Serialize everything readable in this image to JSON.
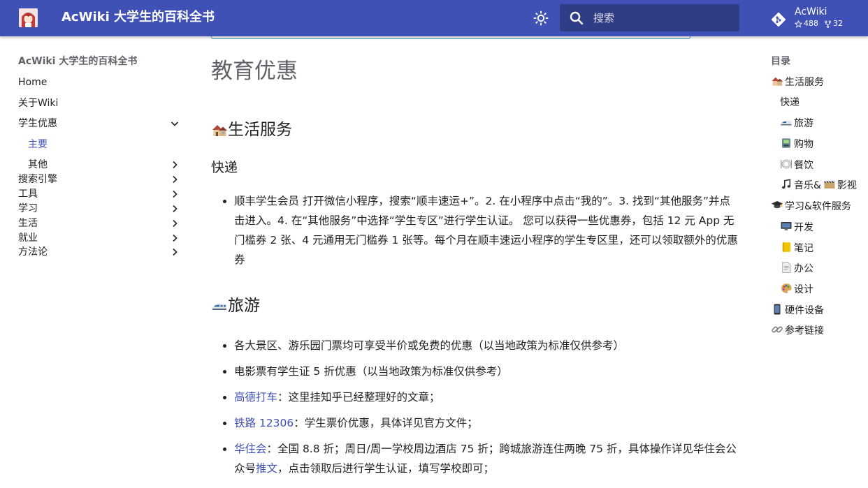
{
  "header": {
    "site_title": "AcWiki 大学生的百科全书",
    "search_placeholder": "搜索",
    "repo": {
      "name": "AcWiki",
      "stars": "488",
      "forks": "32"
    }
  },
  "nav": {
    "title": "AcWiki 大学生的百科全书",
    "items": [
      {
        "label": "Home"
      },
      {
        "label": "关于Wiki"
      },
      {
        "label": "学生优惠"
      },
      {
        "label": "主要"
      },
      {
        "label": "其他"
      },
      {
        "label": "搜索引擎"
      },
      {
        "label": "工具"
      },
      {
        "label": "学习"
      },
      {
        "label": "生活"
      },
      {
        "label": "就业"
      },
      {
        "label": "方法论"
      }
    ]
  },
  "content": {
    "page_title": "教育优惠",
    "section_life": "生活服务",
    "sub_express": "快递",
    "express_item": "顺丰学生会员 打开微信小程序，搜索“顺丰速运+”。2. 在小程序中点击“我的”。3. 找到“其他服务”并点击进入。4. 在“其他服务”中选择“学生专区”进行学生认证。 您可以获得一些优惠券，包括 12 元 App 无门槛券 2 张、4 元通用无门槛券 1 张等。每个月在顺丰速运小程序的学生专区里，还可以领取额外的优惠券",
    "section_travel": "旅游",
    "travel_items": {
      "scenic": "各大景区、游乐园门票均可享受半价或免费的优惠（以当地政策为标准仅供参考）",
      "movie": "电影票有学生证 5 折优惠（以当地政策为标准仅供参考）",
      "amap_link": "高德打车",
      "amap_text": "：这里挂知乎已经整理好的文章；",
      "rail_link": "铁路 12306",
      "rail_text": "：学生票价优惠，具体详见官方文件；",
      "hotel_link": "华住会",
      "hotel_text": "：全国 8.8 折；周日/周一学校周边酒店 75 折；跨城旅游连住两晚 75 折，具体操作详见华住会公众号",
      "hotel_link2": "推文",
      "hotel_text2": "，点击领取后进行学生认证，填写学校即可；"
    }
  },
  "toc": {
    "title": "目录",
    "items": [
      {
        "label": "生活服务"
      },
      {
        "label": "快递"
      },
      {
        "label": "旅游"
      },
      {
        "label": "购物"
      },
      {
        "label": "餐饮"
      },
      {
        "label": "音乐&"
      },
      {
        "label": "影视"
      },
      {
        "label": "学习&软件服务"
      },
      {
        "label": "开发"
      },
      {
        "label": "笔记"
      },
      {
        "label": "办公"
      },
      {
        "label": "设计"
      },
      {
        "label": "硬件设备"
      },
      {
        "label": "参考链接"
      }
    ]
  },
  "colors": {
    "primary": "#4051b5",
    "link": "#4051b5",
    "admonition_border": "#4aa3c7"
  }
}
